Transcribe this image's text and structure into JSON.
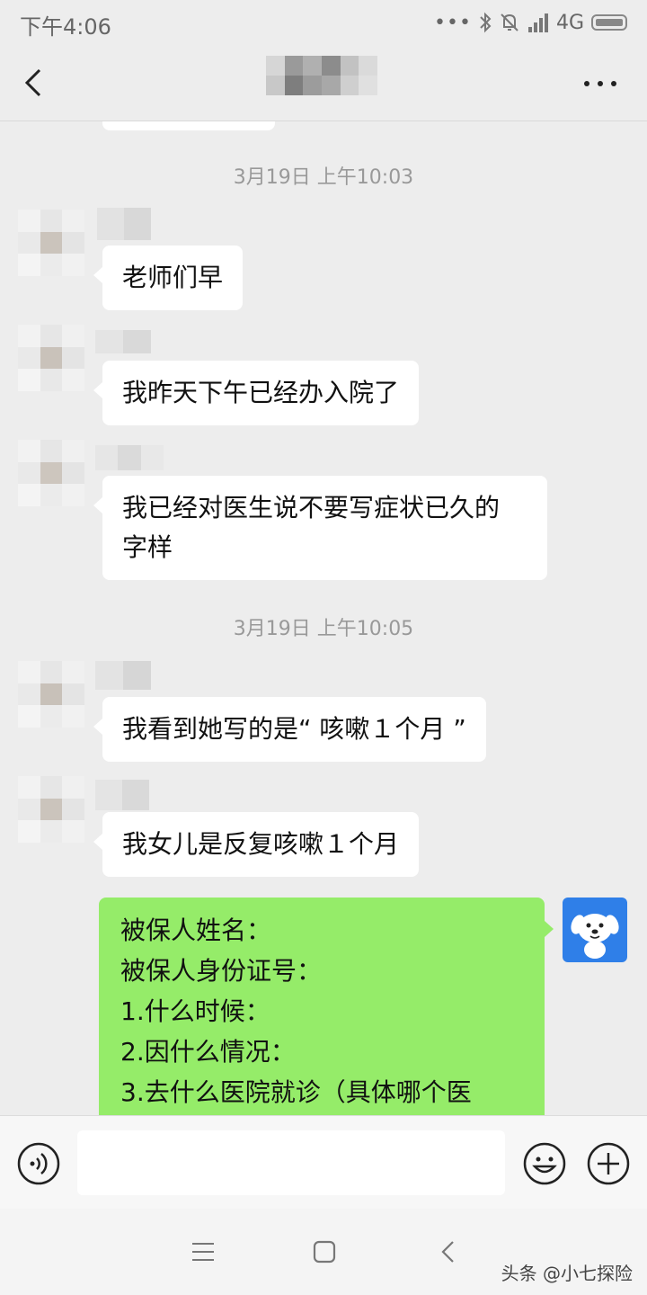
{
  "status_bar": {
    "time": "下午4:06",
    "network": "4G"
  },
  "header": {
    "back_icon": "chevron-left-icon",
    "more_icon": "more-dots-icon"
  },
  "chat": {
    "timestamps": [
      "3月19日 上午10:03",
      "3月19日 上午10:05"
    ],
    "messages": [
      {
        "side": "left",
        "lines": [
          "老师们早"
        ]
      },
      {
        "side": "left",
        "lines": [
          "我昨天下午已经办入院了"
        ]
      },
      {
        "side": "left",
        "lines": [
          "我已经对医生说不要写症状已久的",
          "字样"
        ]
      },
      {
        "side": "left",
        "lines": [
          "我看到她写的是“ 咳嗽１个月 ”"
        ]
      },
      {
        "side": "left",
        "lines": [
          "我女儿是反复咳嗽１个月"
        ]
      },
      {
        "side": "right",
        "lines": [
          "被保人姓名：",
          "被保人身份证号：",
          "1.什么时候：",
          "2.因什么情况：",
          "3.去什么医院就诊（具体哪个医"
        ]
      }
    ]
  },
  "input_bar": {
    "voice_icon": "voice-icon",
    "input_value": "",
    "emoji_icon": "emoji-icon",
    "plus_icon": "plus-icon"
  },
  "system_nav": {
    "menu_icon": "menu-icon",
    "home_icon": "home-icon",
    "back_icon": "back-icon"
  },
  "watermark": "头条 @小七探险",
  "colors": {
    "background": "#ededed",
    "bubble_left": "#ffffff",
    "bubble_right": "#95ec69",
    "avatar_blue": "#2f7fe8"
  }
}
